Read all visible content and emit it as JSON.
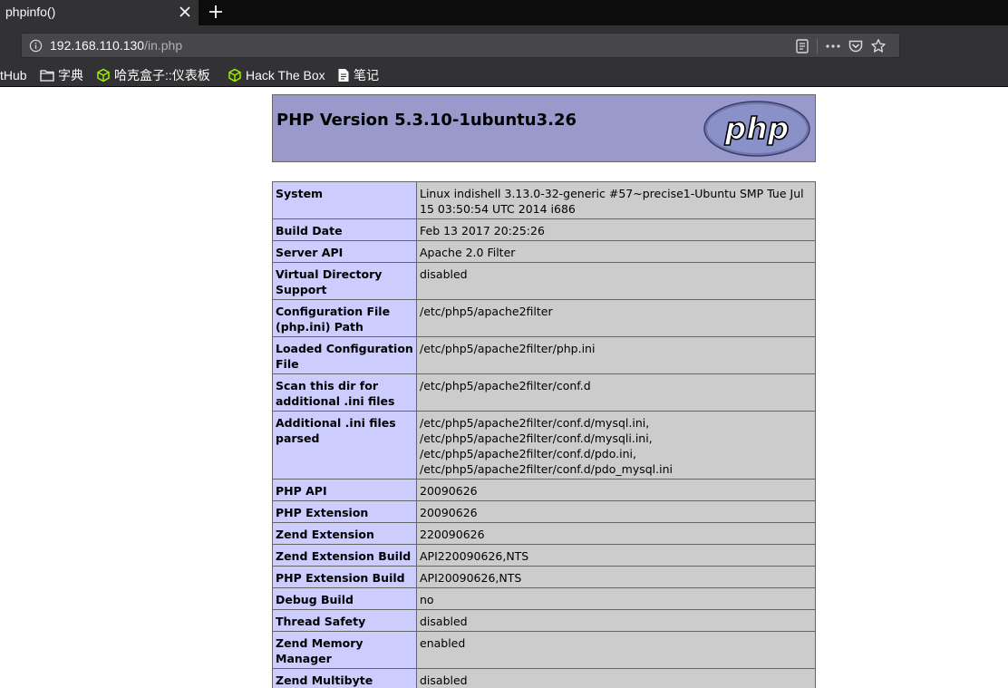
{
  "browser": {
    "tab_title": "phpinfo()",
    "url_host": "192.168.110.130",
    "url_path": "/in.php",
    "bookmarks": [
      {
        "label": "tHub",
        "icon": "none"
      },
      {
        "label": "字典",
        "icon": "folder-icon"
      },
      {
        "label": "哈克盒子::仪表板",
        "icon": "htb-cube-icon"
      },
      {
        "label": "Hack The Box",
        "icon": "htb-cube-icon"
      },
      {
        "label": "笔记",
        "icon": "document-icon"
      }
    ]
  },
  "phpinfo": {
    "title": "PHP Version 5.3.10-1ubuntu3.26",
    "logo_text": "php",
    "rows": [
      {
        "key": "System",
        "value": "Linux indishell 3.13.0-32-generic #57~precise1-Ubuntu SMP Tue Jul 15 03:50:54 UTC 2014 i686"
      },
      {
        "key": "Build Date",
        "value": "Feb 13 2017 20:25:26"
      },
      {
        "key": "Server API",
        "value": "Apache 2.0 Filter"
      },
      {
        "key": "Virtual Directory Support",
        "value": "disabled"
      },
      {
        "key": "Configuration File (php.ini) Path",
        "value": "/etc/php5/apache2filter"
      },
      {
        "key": "Loaded Configuration File",
        "value": "/etc/php5/apache2filter/php.ini"
      },
      {
        "key": "Scan this dir for additional .ini files",
        "value": "/etc/php5/apache2filter/conf.d"
      },
      {
        "key": "Additional .ini files parsed",
        "value": "/etc/php5/apache2filter/conf.d/mysql.ini, /etc/php5/apache2filter/conf.d/mysqli.ini, /etc/php5/apache2filter/conf.d/pdo.ini, /etc/php5/apache2filter/conf.d/pdo_mysql.ini"
      },
      {
        "key": "PHP API",
        "value": "20090626"
      },
      {
        "key": "PHP Extension",
        "value": "20090626"
      },
      {
        "key": "Zend Extension",
        "value": "220090626"
      },
      {
        "key": "Zend Extension Build",
        "value": "API220090626,NTS"
      },
      {
        "key": "PHP Extension Build",
        "value": "API20090626,NTS"
      },
      {
        "key": "Debug Build",
        "value": "no"
      },
      {
        "key": "Thread Safety",
        "value": "disabled"
      },
      {
        "key": "Zend Memory Manager",
        "value": "enabled"
      },
      {
        "key": "Zend Multibyte Support",
        "value": "disabled"
      }
    ]
  }
}
